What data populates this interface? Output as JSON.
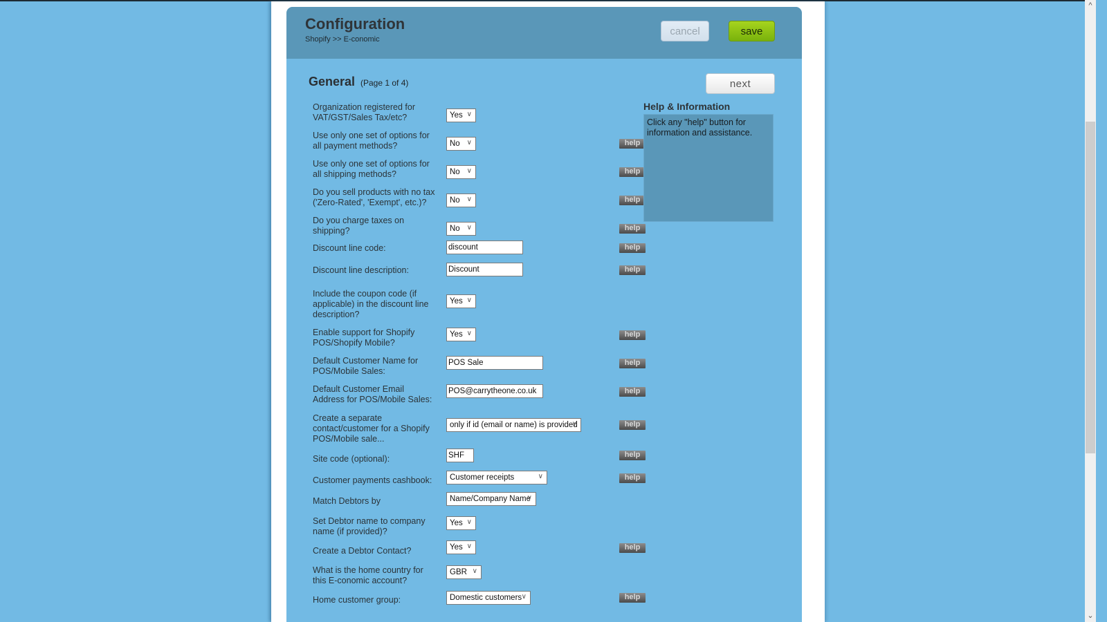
{
  "header": {
    "title": "Configuration",
    "breadcrumb": "Shopify >> E-conomic",
    "cancel_label": "cancel",
    "save_label": "save"
  },
  "section": {
    "title": "General",
    "page_info": "(Page 1 of 4)",
    "next_label": "next"
  },
  "help_panel": {
    "title": "Help & Information",
    "text": "Click any \"help\" button for information and assistance."
  },
  "help_label": "help",
  "chevron_glyph": "∨",
  "fields": [
    {
      "label": "Organization registered for VAT/GST/Sales Tax/etc?",
      "type": "select",
      "value": "Yes",
      "help": false
    },
    {
      "label": "Use only one set of options for all payment methods?",
      "type": "select",
      "value": "No",
      "help": true
    },
    {
      "label": "Use only one set of options for all shipping methods?",
      "type": "select",
      "value": "No",
      "help": true
    },
    {
      "label": "Do you sell products with no tax ('Zero-Rated', 'Exempt', etc.)?",
      "type": "select",
      "value": "No",
      "help": true
    },
    {
      "label": "Do you charge taxes on shipping?",
      "type": "select",
      "value": "No",
      "help": true
    },
    {
      "label": "Discount line code:",
      "type": "input",
      "value": "discount",
      "help": true
    },
    {
      "label": "Discount line description:",
      "type": "input",
      "value": "Discount",
      "help": true
    },
    {
      "label": "Include the coupon code (if applicable) in the discount line description?",
      "type": "select",
      "value": "Yes",
      "help": false
    },
    {
      "label": "Enable support for Shopify POS/Shopify Mobile?",
      "type": "select",
      "value": "Yes",
      "help": true
    },
    {
      "label": "Default Customer Name for POS/Mobile Sales:",
      "type": "input",
      "value": "POS Sale",
      "help": true
    },
    {
      "label": "Default Customer Email Address for POS/Mobile Sales:",
      "type": "input",
      "value": "POS@carrytheone.co.uk",
      "help": true
    },
    {
      "label": "Create a separate contact/customer for a Shopify POS/Mobile sale...",
      "type": "select",
      "value": "only if id (email or name) is provided",
      "help": true
    },
    {
      "label": "Site code (optional):",
      "type": "input",
      "value": "SHF",
      "help": true
    },
    {
      "label": "Customer payments cashbook:",
      "type": "select",
      "value": "Customer receipts",
      "help": true
    },
    {
      "label": "Match Debtors by",
      "type": "select",
      "value": "Name/Company Name",
      "help": false
    },
    {
      "label": "Set Debtor name to company name (if provided)?",
      "type": "select",
      "value": "Yes",
      "help": false
    },
    {
      "label": "Create a Debtor Contact?",
      "type": "select",
      "value": "Yes",
      "help": true
    },
    {
      "label": "What is the home country for this E-conomic account?",
      "type": "select",
      "value": "GBR",
      "help": false
    },
    {
      "label": "Home customer group:",
      "type": "select",
      "value": "Domestic customers",
      "help": true
    }
  ],
  "colors": {
    "background": "#72bae4",
    "header": "#5a97b8",
    "save": "#8cc414"
  }
}
